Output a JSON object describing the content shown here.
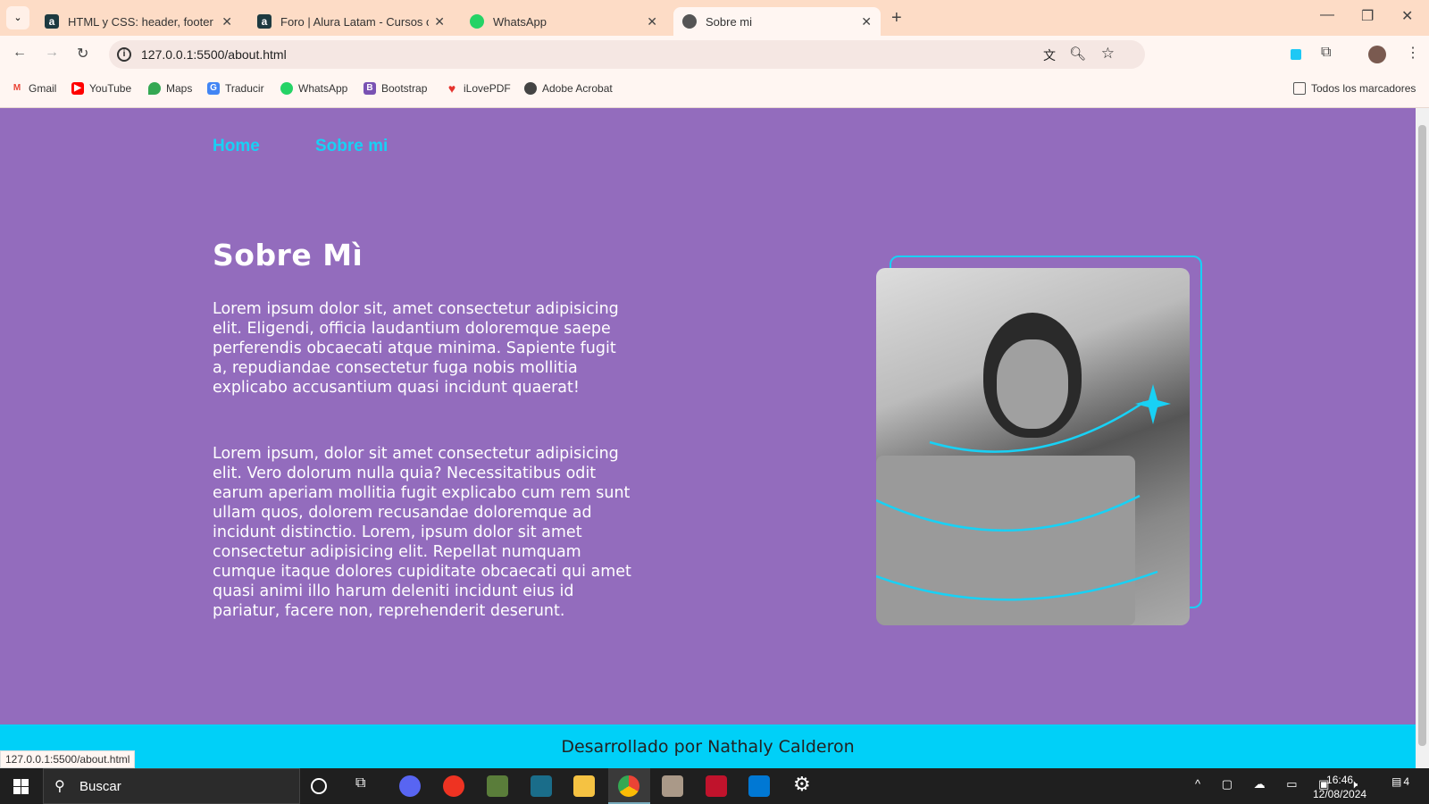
{
  "browser": {
    "tabs": [
      {
        "title": "HTML y CSS: header, footer y va",
        "icon": "alura-icon"
      },
      {
        "title": "Foro | Alura Latam - Cursos onli",
        "icon": "alura-icon"
      },
      {
        "title": "WhatsApp",
        "icon": "whatsapp-icon"
      },
      {
        "title": "Sobre mi",
        "icon": "globe-icon",
        "active": true
      }
    ],
    "url": "127.0.0.1:5500/about.html",
    "bookmarks": [
      "Gmail",
      "YouTube",
      "Maps",
      "Traducir",
      "WhatsApp",
      "Bootstrap",
      "iLovePDF",
      "Adobe Acrobat"
    ],
    "all_bookmarks": "Todos los marcadores",
    "status_url": "127.0.0.1:5500/about.html"
  },
  "page": {
    "nav": [
      "Home",
      "Sobre mi"
    ],
    "title": "Sobre Mì",
    "paragraphs": [
      "Lorem ipsum dolor sit, amet consectetur adipisicing elit. Eligendi, officia laudantium doloremque saepe perferendis obcaecati atque minima. Sapiente fugit a, repudiandae consectetur fuga nobis mollitia explicabo accusantium quasi incidunt quaerat!",
      "Lorem ipsum, dolor sit amet consectetur adipisicing elit. Vero dolorum nulla quia? Necessitatibus odit earum aperiam mollitia fugit explicabo cum rem sunt ullam quos, dolorem recusandae doloremque ad incidunt distinctio. Lorem, ipsum dolor sit amet consectetur adipisicing elit. Repellat numquam cumque itaque dolores cupiditate obcaecati qui amet quasi animi illo harum deleniti incidunt eius id pariatur, facere non, reprehenderit deserunt."
    ],
    "footer": "Desarrollado por Nathaly Calderon",
    "colors": {
      "background": "#936cbd",
      "accent": "#18d1f5",
      "footer": "#00d0f8"
    }
  },
  "taskbar": {
    "search_placeholder": "Buscar",
    "time": "16:46",
    "date": "12/08/2024",
    "notifications": "4"
  }
}
